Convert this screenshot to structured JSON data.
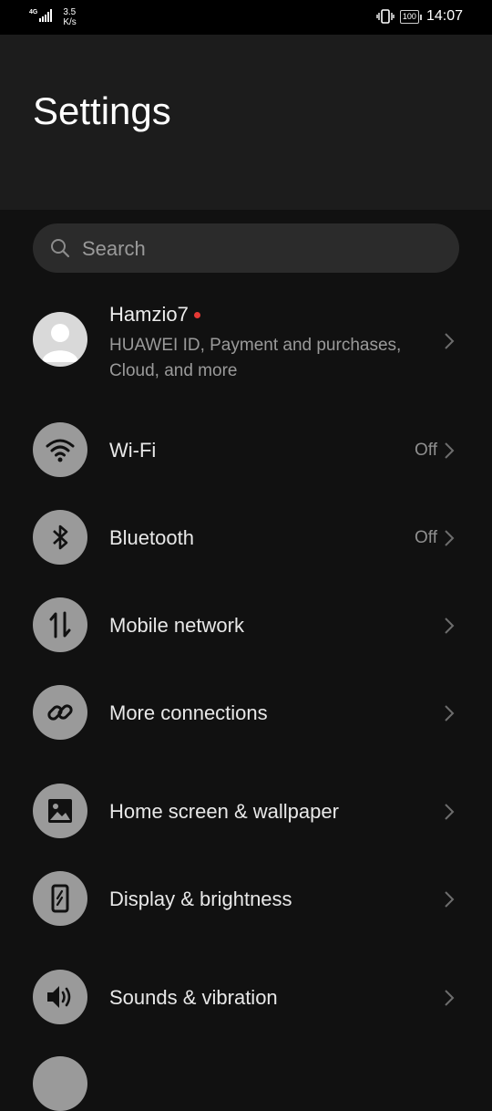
{
  "status_bar": {
    "network": "4G",
    "speed": "3.5",
    "speed_unit": "K/s",
    "battery": "100",
    "time": "14:07"
  },
  "header": {
    "title": "Settings"
  },
  "search": {
    "placeholder": "Search"
  },
  "account": {
    "name": "Hamzio7",
    "subtitle": "HUAWEI ID, Payment and purchases, Cloud, and more",
    "avatar_icon": "user-avatar-icon",
    "badge_color": "#e53935"
  },
  "items": [
    {
      "label": "Wi-Fi",
      "value": "Off",
      "icon": "wifi-icon"
    },
    {
      "label": "Bluetooth",
      "value": "Off",
      "icon": "bluetooth-icon"
    },
    {
      "label": "Mobile network",
      "value": "",
      "icon": "mobile-data-icon"
    },
    {
      "label": "More connections",
      "value": "",
      "icon": "link-icon"
    },
    {
      "label": "Home screen & wallpaper",
      "value": "",
      "icon": "image-icon"
    },
    {
      "label": "Display & brightness",
      "value": "",
      "icon": "display-icon"
    },
    {
      "label": "Sounds & vibration",
      "value": "",
      "icon": "speaker-icon"
    }
  ],
  "colors": {
    "background": "#111111",
    "header_background": "#1c1c1c",
    "icon_circle": "#9a9a9a",
    "secondary_text": "#9a9a9a"
  }
}
